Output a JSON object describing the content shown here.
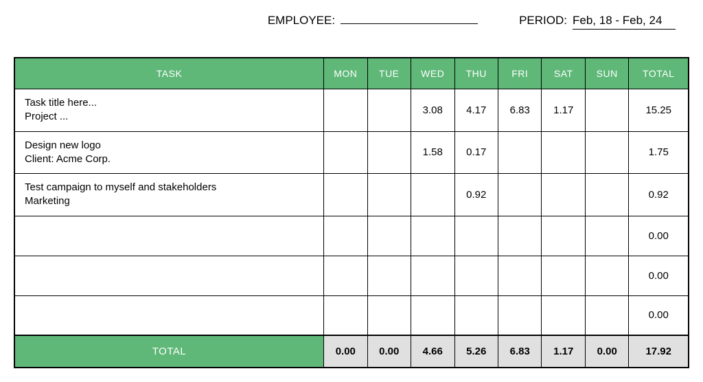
{
  "header": {
    "employee_label": "EMPLOYEE:",
    "employee_value": "",
    "period_label": "PERIOD:",
    "period_value": "Feb, 18 - Feb, 24"
  },
  "table": {
    "columns": {
      "task": "TASK",
      "days": [
        "MON",
        "TUE",
        "WED",
        "THU",
        "FRI",
        "SAT",
        "SUN"
      ],
      "total": "TOTAL"
    },
    "rows": [
      {
        "title": "Task title here...",
        "subtitle": "Project ...",
        "days": [
          "",
          "",
          "3.08",
          "4.17",
          "6.83",
          "1.17",
          ""
        ],
        "total": "15.25"
      },
      {
        "title": "Design new logo",
        "subtitle": "Client: Acme Corp.",
        "days": [
          "",
          "",
          "1.58",
          "0.17",
          "",
          "",
          ""
        ],
        "total": "1.75"
      },
      {
        "title": "Test campaign to myself and stakeholders",
        "subtitle": "Marketing",
        "days": [
          "",
          "",
          "",
          "0.92",
          "",
          "",
          ""
        ],
        "total": "0.92"
      },
      {
        "title": "",
        "subtitle": "",
        "days": [
          "",
          "",
          "",
          "",
          "",
          "",
          ""
        ],
        "total": "0.00"
      },
      {
        "title": "",
        "subtitle": "",
        "days": [
          "",
          "",
          "",
          "",
          "",
          "",
          ""
        ],
        "total": "0.00"
      },
      {
        "title": "",
        "subtitle": "",
        "days": [
          "",
          "",
          "",
          "",
          "",
          "",
          ""
        ],
        "total": "0.00"
      }
    ],
    "footer": {
      "label": "TOTAL",
      "days": [
        "0.00",
        "0.00",
        "4.66",
        "5.26",
        "6.83",
        "1.17",
        "0.00"
      ],
      "total": "17.92"
    }
  }
}
